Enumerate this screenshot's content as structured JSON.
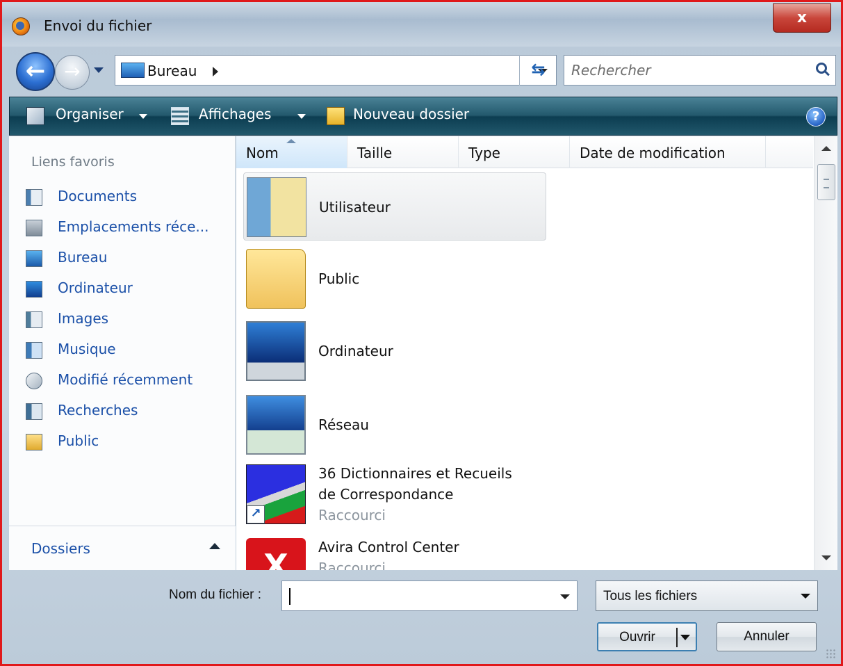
{
  "window": {
    "title": "Envoi du fichier",
    "close_label": "x",
    "border_color": "#e0191b"
  },
  "address_bar": {
    "location": "Bureau",
    "refresh_icon": "refresh-icon"
  },
  "search": {
    "placeholder": "Rechercher"
  },
  "toolbar": {
    "organize": "Organiser",
    "views": "Affichages",
    "new_folder": "Nouveau dossier",
    "help": "?"
  },
  "favorites": {
    "title": "Liens favoris",
    "items": [
      {
        "label": "Documents",
        "icon": "documents-icon"
      },
      {
        "label": "Emplacements réce...",
        "icon": "recent-places-icon"
      },
      {
        "label": "Bureau",
        "icon": "desktop-icon"
      },
      {
        "label": "Ordinateur",
        "icon": "computer-icon"
      },
      {
        "label": "Images",
        "icon": "pictures-icon"
      },
      {
        "label": "Musique",
        "icon": "music-icon"
      },
      {
        "label": "Modifié récemment",
        "icon": "recently-changed-icon"
      },
      {
        "label": "Recherches",
        "icon": "searches-icon"
      },
      {
        "label": "Public",
        "icon": "public-folder-icon"
      }
    ],
    "folders_label": "Dossiers"
  },
  "columns": [
    "Nom",
    "Taille",
    "Type",
    "Date de modification"
  ],
  "files": [
    {
      "name": "Utilisateur",
      "icon": "user-folder-icon",
      "selected": true
    },
    {
      "name": "Public",
      "icon": "folder-icon"
    },
    {
      "name": "Ordinateur",
      "icon": "computer-icon"
    },
    {
      "name": "Réseau",
      "icon": "network-icon"
    },
    {
      "name_line1": "36 Dictionnaires et Recueils",
      "name_line2": "de Correspondance",
      "sub": "Raccourci",
      "icon": "dictionary-icon"
    },
    {
      "name": "Avira Control Center",
      "sub": "Raccourci",
      "icon": "avira-icon"
    }
  ],
  "footer": {
    "filename_label": "Nom du fichier :",
    "filename_value": "",
    "filetype": "Tous les fichiers",
    "open_label": "Ouvrir",
    "cancel_label": "Annuler"
  }
}
